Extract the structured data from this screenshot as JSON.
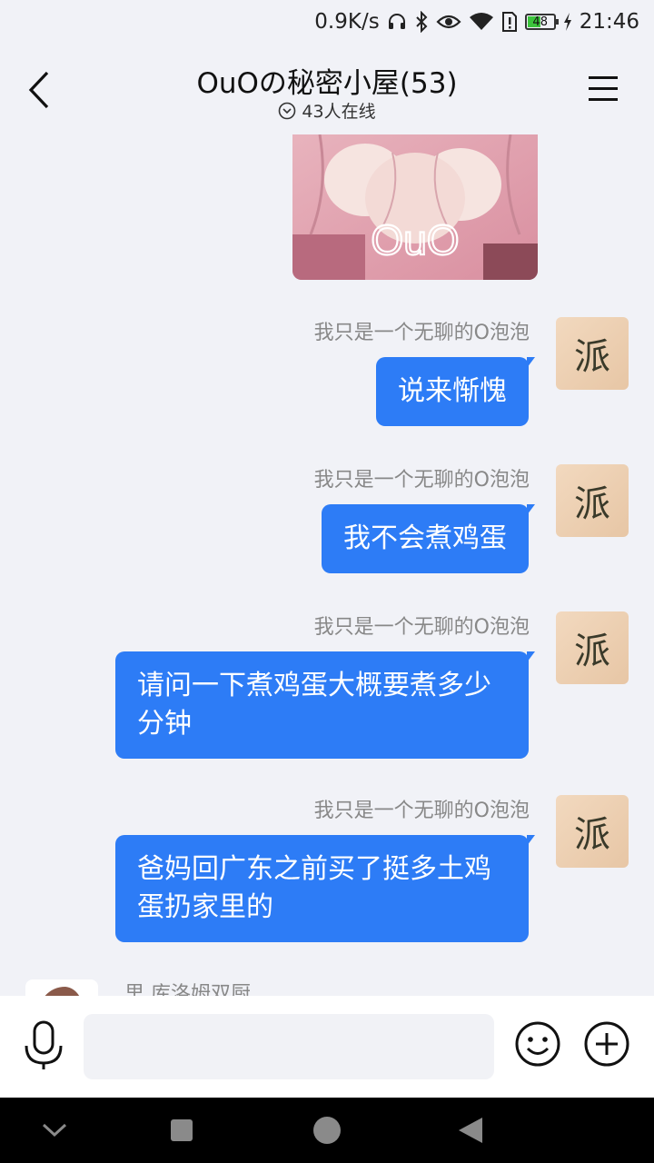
{
  "status_bar": {
    "net_speed": "0.9K/s",
    "battery_level": "48",
    "time": "21:46",
    "icons": [
      "headset-icon",
      "bluetooth-icon",
      "eye-icon",
      "wifi-icon",
      "sim-alert-icon",
      "battery-icon",
      "charging-icon"
    ]
  },
  "header": {
    "title": "OuOの秘密小屋(53)",
    "online": "43人在线",
    "icons": [
      "back-arrow-icon",
      "chevron-circle-icon",
      "hamburger-menu-icon"
    ]
  },
  "shared_image": {
    "overlay_text": "OuO"
  },
  "messages": [
    {
      "sender": "我只是一个无聊的O泡泡",
      "avatar_glyph": "派",
      "text": "说来惭愧"
    },
    {
      "sender": "我只是一个无聊的O泡泡",
      "avatar_glyph": "派",
      "text": "我不会煮鸡蛋"
    },
    {
      "sender": "我只是一个无聊的O泡泡",
      "avatar_glyph": "派",
      "text": "请问一下煮鸡蛋大概要煮多少分钟"
    },
    {
      "sender": "我只是一个无聊的O泡泡",
      "avatar_glyph": "派",
      "text": "爸妈回广东之前买了挺多土鸡蛋扔家里的"
    }
  ],
  "next_message": {
    "sender": "里 库洛姆双厨"
  },
  "input_bar": {
    "value": "",
    "placeholder": "",
    "icons": [
      "microphone-icon",
      "emoji-icon",
      "plus-icon"
    ]
  },
  "nav_bar": {
    "icons": [
      "nav-down-icon",
      "nav-recents-icon",
      "nav-home-icon",
      "nav-back-icon"
    ]
  },
  "colors": {
    "bubble": "#2d7cf6",
    "background": "#f1f2f7",
    "sender_text": "#888888"
  }
}
